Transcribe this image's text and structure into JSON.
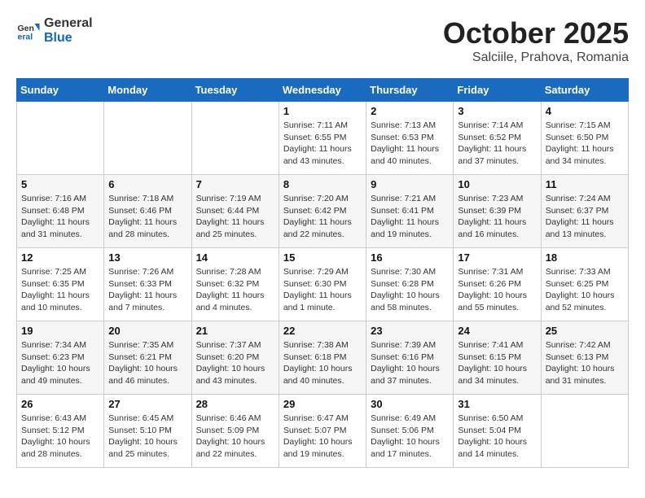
{
  "header": {
    "logo_general": "General",
    "logo_blue": "Blue",
    "month_title": "October 2025",
    "location": "Salciile, Prahova, Romania"
  },
  "days_of_week": [
    "Sunday",
    "Monday",
    "Tuesday",
    "Wednesday",
    "Thursday",
    "Friday",
    "Saturday"
  ],
  "weeks": [
    [
      {
        "day": "",
        "info": ""
      },
      {
        "day": "",
        "info": ""
      },
      {
        "day": "",
        "info": ""
      },
      {
        "day": "1",
        "info": "Sunrise: 7:11 AM\nSunset: 6:55 PM\nDaylight: 11 hours\nand 43 minutes."
      },
      {
        "day": "2",
        "info": "Sunrise: 7:13 AM\nSunset: 6:53 PM\nDaylight: 11 hours\nand 40 minutes."
      },
      {
        "day": "3",
        "info": "Sunrise: 7:14 AM\nSunset: 6:52 PM\nDaylight: 11 hours\nand 37 minutes."
      },
      {
        "day": "4",
        "info": "Sunrise: 7:15 AM\nSunset: 6:50 PM\nDaylight: 11 hours\nand 34 minutes."
      }
    ],
    [
      {
        "day": "5",
        "info": "Sunrise: 7:16 AM\nSunset: 6:48 PM\nDaylight: 11 hours\nand 31 minutes."
      },
      {
        "day": "6",
        "info": "Sunrise: 7:18 AM\nSunset: 6:46 PM\nDaylight: 11 hours\nand 28 minutes."
      },
      {
        "day": "7",
        "info": "Sunrise: 7:19 AM\nSunset: 6:44 PM\nDaylight: 11 hours\nand 25 minutes."
      },
      {
        "day": "8",
        "info": "Sunrise: 7:20 AM\nSunset: 6:42 PM\nDaylight: 11 hours\nand 22 minutes."
      },
      {
        "day": "9",
        "info": "Sunrise: 7:21 AM\nSunset: 6:41 PM\nDaylight: 11 hours\nand 19 minutes."
      },
      {
        "day": "10",
        "info": "Sunrise: 7:23 AM\nSunset: 6:39 PM\nDaylight: 11 hours\nand 16 minutes."
      },
      {
        "day": "11",
        "info": "Sunrise: 7:24 AM\nSunset: 6:37 PM\nDaylight: 11 hours\nand 13 minutes."
      }
    ],
    [
      {
        "day": "12",
        "info": "Sunrise: 7:25 AM\nSunset: 6:35 PM\nDaylight: 11 hours\nand 10 minutes."
      },
      {
        "day": "13",
        "info": "Sunrise: 7:26 AM\nSunset: 6:33 PM\nDaylight: 11 hours\nand 7 minutes."
      },
      {
        "day": "14",
        "info": "Sunrise: 7:28 AM\nSunset: 6:32 PM\nDaylight: 11 hours\nand 4 minutes."
      },
      {
        "day": "15",
        "info": "Sunrise: 7:29 AM\nSunset: 6:30 PM\nDaylight: 11 hours\nand 1 minute."
      },
      {
        "day": "16",
        "info": "Sunrise: 7:30 AM\nSunset: 6:28 PM\nDaylight: 10 hours\nand 58 minutes."
      },
      {
        "day": "17",
        "info": "Sunrise: 7:31 AM\nSunset: 6:26 PM\nDaylight: 10 hours\nand 55 minutes."
      },
      {
        "day": "18",
        "info": "Sunrise: 7:33 AM\nSunset: 6:25 PM\nDaylight: 10 hours\nand 52 minutes."
      }
    ],
    [
      {
        "day": "19",
        "info": "Sunrise: 7:34 AM\nSunset: 6:23 PM\nDaylight: 10 hours\nand 49 minutes."
      },
      {
        "day": "20",
        "info": "Sunrise: 7:35 AM\nSunset: 6:21 PM\nDaylight: 10 hours\nand 46 minutes."
      },
      {
        "day": "21",
        "info": "Sunrise: 7:37 AM\nSunset: 6:20 PM\nDaylight: 10 hours\nand 43 minutes."
      },
      {
        "day": "22",
        "info": "Sunrise: 7:38 AM\nSunset: 6:18 PM\nDaylight: 10 hours\nand 40 minutes."
      },
      {
        "day": "23",
        "info": "Sunrise: 7:39 AM\nSunset: 6:16 PM\nDaylight: 10 hours\nand 37 minutes."
      },
      {
        "day": "24",
        "info": "Sunrise: 7:41 AM\nSunset: 6:15 PM\nDaylight: 10 hours\nand 34 minutes."
      },
      {
        "day": "25",
        "info": "Sunrise: 7:42 AM\nSunset: 6:13 PM\nDaylight: 10 hours\nand 31 minutes."
      }
    ],
    [
      {
        "day": "26",
        "info": "Sunrise: 6:43 AM\nSunset: 5:12 PM\nDaylight: 10 hours\nand 28 minutes."
      },
      {
        "day": "27",
        "info": "Sunrise: 6:45 AM\nSunset: 5:10 PM\nDaylight: 10 hours\nand 25 minutes."
      },
      {
        "day": "28",
        "info": "Sunrise: 6:46 AM\nSunset: 5:09 PM\nDaylight: 10 hours\nand 22 minutes."
      },
      {
        "day": "29",
        "info": "Sunrise: 6:47 AM\nSunset: 5:07 PM\nDaylight: 10 hours\nand 19 minutes."
      },
      {
        "day": "30",
        "info": "Sunrise: 6:49 AM\nSunset: 5:06 PM\nDaylight: 10 hours\nand 17 minutes."
      },
      {
        "day": "31",
        "info": "Sunrise: 6:50 AM\nSunset: 5:04 PM\nDaylight: 10 hours\nand 14 minutes."
      },
      {
        "day": "",
        "info": ""
      }
    ]
  ]
}
